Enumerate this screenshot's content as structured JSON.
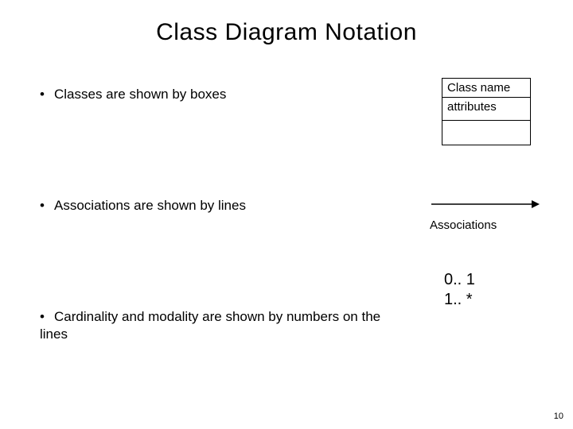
{
  "title": "Class Diagram Notation",
  "bullets": {
    "b1": "Classes are shown by boxes",
    "b2": "Associations are shown by lines",
    "b3": "Cardinality and modality  are shown by numbers on the lines"
  },
  "classbox": {
    "name": "Class name",
    "attributes": "attributes",
    "operations": ""
  },
  "association": {
    "label": "Associations"
  },
  "cardinality": {
    "line1": "0.. 1",
    "line2": "1.. *"
  },
  "page_number": "10",
  "bullet_char": "•"
}
